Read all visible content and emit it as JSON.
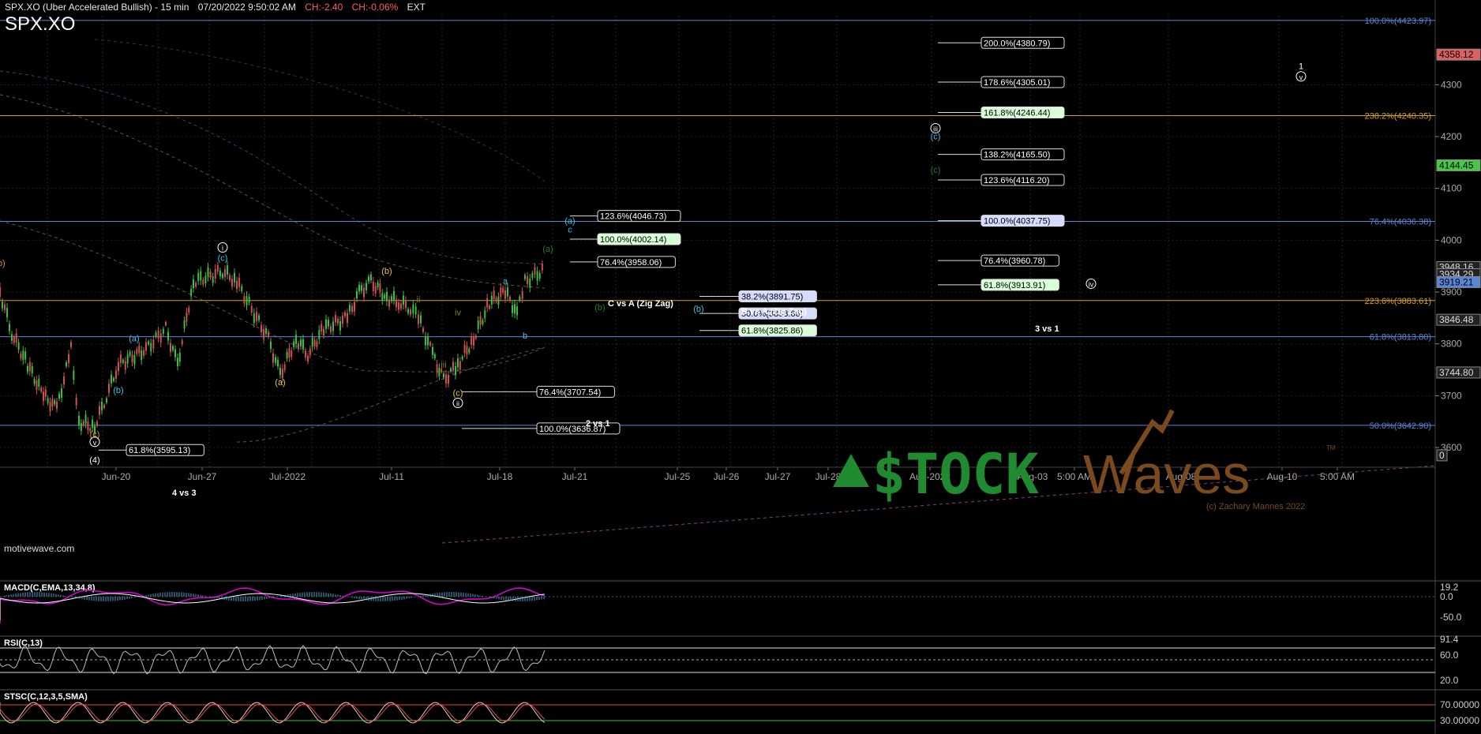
{
  "header": {
    "title": "SPX.XO (Uber Accelerated Bullish) - 15 min",
    "timestamp": "07/20/2022 9:50:02 AM",
    "change_points": "CH:-2.40",
    "change_percent": "CH:-0.06%",
    "session": "EXT",
    "symbol": "SPX.XO"
  },
  "footer": {
    "watermark": "motivewave.com"
  },
  "logo": {
    "brand": "STOCKWaves",
    "brand_part1": "$TOCK",
    "brand_part2": "Waves",
    "tm": "TM",
    "copyright": "(c) Zachary Mannes 2022"
  },
  "colors": {
    "background": "#000000",
    "up": "#3cbf3c",
    "down": "#d05050",
    "fib_blue": "#5a86d8",
    "fib_gold": "#d4a017",
    "cyan": "#33c6e0"
  },
  "chart_data": {
    "type": "line",
    "price_axis": {
      "ticks": [
        4300,
        4200,
        4100,
        4000,
        3900,
        3800,
        3700,
        3600
      ],
      "range": [
        3560,
        4433
      ]
    },
    "time_axis": {
      "labels": [
        "Jun-20",
        "Jun-27",
        "Jul-2022",
        "Jul-11",
        "Jul-18",
        "Jul-21",
        "Jul-25",
        "Jul-26",
        "Jul-27",
        "Jul-28",
        "Aug-2022",
        "Aug-03",
        "5:00 AM",
        "Aug-08",
        "Aug-10",
        "5:00 AM"
      ]
    },
    "price_path": [
      [
        "06-14",
        3900
      ],
      [
        "06-15",
        3820
      ],
      [
        "06-16",
        3760
      ],
      [
        "06-16b",
        3700
      ],
      [
        "06-17",
        3675
      ],
      [
        "06-17b",
        3790
      ],
      [
        "06-17c",
        3650
      ],
      [
        "06-19",
        3640
      ],
      [
        "06-21",
        3700
      ],
      [
        "06-22",
        3760
      ],
      [
        "06-23",
        3790
      ],
      [
        "06-24",
        3830
      ],
      [
        "06-25",
        3760
      ],
      [
        "06-26",
        3920
      ],
      [
        "06-27",
        3940
      ],
      [
        "06-28",
        3920
      ],
      [
        "06-29",
        3850
      ],
      [
        "06-30",
        3810
      ],
      [
        "07-01",
        3740
      ],
      [
        "07-02",
        3810
      ],
      [
        "07-04",
        3780
      ],
      [
        "07-05",
        3830
      ],
      [
        "07-06",
        3850
      ],
      [
        "07-07",
        3900
      ],
      [
        "07-08",
        3920
      ],
      [
        "07-09",
        3890
      ],
      [
        "07-10",
        3880
      ],
      [
        "07-11",
        3870
      ],
      [
        "07-12",
        3850
      ],
      [
        "07-13",
        3780
      ],
      [
        "07-14",
        3730
      ],
      [
        "07-15",
        3760
      ],
      [
        "07-16",
        3810
      ],
      [
        "07-17",
        3880
      ],
      [
        "07-18",
        3900
      ],
      [
        "07-18b",
        3860
      ],
      [
        "07-19",
        3920
      ],
      [
        "07-20",
        3945
      ]
    ],
    "fib_levels": [
      {
        "label": "100.0%(4423.97)",
        "value": 4423.97,
        "color": "blue"
      },
      {
        "label": "238.2%(4240.35)",
        "value": 4240.35,
        "color": "gold"
      },
      {
        "label": "76.4%(4036.38)",
        "value": 4036.38,
        "color": "blue"
      },
      {
        "label": "223.6%(3883.61)",
        "value": 3883.61,
        "color": "gold"
      },
      {
        "label": "61.8%(3813.80)",
        "value": 3813.8,
        "color": "blue"
      },
      {
        "label": "50.0%(3642.90)",
        "value": 3642.9,
        "color": "blue"
      }
    ],
    "projection_boxes": [
      {
        "label": "200.0%(4380.79)",
        "value": 4380.79,
        "style": "plain",
        "group": "right"
      },
      {
        "label": "178.6%(4305.01)",
        "value": 4305.01,
        "style": "plain",
        "group": "right"
      },
      {
        "label": "161.8%(4246.44)",
        "value": 4246.44,
        "style": "green",
        "group": "right"
      },
      {
        "label": "138.2%(4165.50)",
        "value": 4165.5,
        "style": "plain",
        "group": "right"
      },
      {
        "label": "123.6%(4116.20)",
        "value": 4116.2,
        "style": "plain",
        "group": "right"
      },
      {
        "label": "100.0%(4037.75)",
        "value": 4037.75,
        "style": "blue",
        "group": "right"
      },
      {
        "label": "76.4%(3960.78)",
        "value": 3960.78,
        "style": "plain",
        "group": "right"
      },
      {
        "label": "61.8%(3913.91)",
        "value": 3913.91,
        "style": "green",
        "group": "right"
      },
      {
        "label": "123.6%(4046.73)",
        "value": 4046.73,
        "style": "plain",
        "group": "mid"
      },
      {
        "label": "100.0%(4002.14)",
        "value": 4002.14,
        "style": "green",
        "group": "mid"
      },
      {
        "label": "76.4%(3958.06)",
        "value": 3958.06,
        "style": "plain",
        "group": "mid"
      },
      {
        "label": "38.2%(3891.75)",
        "value": 3891.75,
        "style": "blue",
        "group": "b"
      },
      {
        "label": "50.0%(3858.66)",
        "value": 3858.66,
        "style": "blue",
        "group": "b"
      },
      {
        "label": "61.8%(3825.86)",
        "value": 3825.86,
        "style": "green",
        "group": "b"
      },
      {
        "label": "76.4%(3707.54)",
        "value": 3707.54,
        "style": "plain",
        "group": "low"
      },
      {
        "label": "100.0%(3636.87)",
        "value": 3636.87,
        "style": "plain",
        "group": "low"
      },
      {
        "label": "61.8%(3595.13)",
        "value": 3595.13,
        "style": "plain",
        "group": "left"
      }
    ],
    "group_titles": {
      "mid": "C vs A (Zig Zag)",
      "b": "B vs A (Zig Zag)",
      "right": "3 vs 1",
      "low": "2 vs 1",
      "left": "4 vs 3"
    },
    "axis_badges": [
      {
        "label": "100.0%(4423.97)",
        "value": 4423.97,
        "style": "fibtext"
      },
      {
        "label": "4358.12",
        "value": 4358.12,
        "style": "red"
      },
      {
        "label": "4144.45",
        "value": 4144.45,
        "style": "green"
      },
      {
        "label": "3948.16",
        "value": 3948.16,
        "style": "plain"
      },
      {
        "label": "3934.29",
        "value": 3934.29,
        "style": "plain"
      },
      {
        "label": "3919.21",
        "value": 3919.21,
        "style": "blue"
      },
      {
        "label": "3846.48",
        "value": 3846.48,
        "style": "plain"
      },
      {
        "label": "3744.80",
        "value": 3744.8,
        "style": "plain"
      },
      {
        "label": "0",
        "value": 3585,
        "style": "plain"
      }
    ],
    "wave_labels": [
      {
        "t": "(b)",
        "d": "06-14",
        "v": 3950,
        "c": "#e08a3c"
      },
      {
        "t": "(a)",
        "d": "06-22b",
        "v": 3805,
        "c": "#33c6e0"
      },
      {
        "t": "(b)",
        "d": "06-22",
        "v": 3705,
        "c": "#33c6e0"
      },
      {
        "t": "(c)",
        "d": "06-19",
        "v": 3620,
        "c": "#e08a3c"
      },
      {
        "t": "(4)",
        "d": "06-19",
        "v": 3570,
        "c": "#ffffff"
      },
      {
        "t": "(c)",
        "d": "06-27",
        "v": 3960,
        "c": "#33c6e0"
      },
      {
        "t": "(a)",
        "d": "07-01",
        "v": 3720,
        "c": "#e6c84a"
      },
      {
        "t": "(b)",
        "d": "07-09",
        "v": 3935,
        "c": "#e6c84a"
      },
      {
        "t": "ii",
        "d": "07-12",
        "v": 3880,
        "c": "#8a7a3a"
      },
      {
        "t": "iv",
        "d": "07-15",
        "v": 3855,
        "c": "#8a7a3a"
      },
      {
        "t": "iii",
        "d": "07-14",
        "v": 3755,
        "c": "#8a7a3a"
      },
      {
        "t": "(c)",
        "d": "07-15",
        "v": 3700,
        "c": "#e6c84a"
      },
      {
        "t": "a",
        "d": "07-18",
        "v": 3915,
        "c": "#33c6e0"
      },
      {
        "t": "b",
        "d": "07-19",
        "v": 3810,
        "c": "#33c6e0"
      },
      {
        "t": "c",
        "d": "07-20c",
        "v": 4015,
        "c": "#33c6e0"
      },
      {
        "t": "(a)",
        "d": "07-20c",
        "v": 4032,
        "c": "#33c6e0"
      },
      {
        "t": "(a)",
        "d": "07-21",
        "v": 3978,
        "c": "#2a7a2a"
      },
      {
        "t": "(b)",
        "d": "07-22",
        "v": 3865,
        "c": "#2a7a2a"
      },
      {
        "t": "(b)",
        "d": "07-26",
        "v": 3862,
        "c": "#33c6e0"
      },
      {
        "t": "(c)",
        "d": "08-02",
        "v": 4130,
        "c": "#2a7a2a"
      },
      {
        "t": "(c)",
        "d": "08-02",
        "v": 4195,
        "c": "#33c6e0"
      },
      {
        "t": "1",
        "d": "08-11",
        "v": 4330,
        "c": "#ffffff"
      }
    ],
    "circled_labels": [
      {
        "t": "i",
        "d": "06-27",
        "v": 3980
      },
      {
        "t": "ii",
        "d": "07-15",
        "v": 3680
      },
      {
        "t": "iii",
        "d": "08-02",
        "v": 4210
      },
      {
        "t": "iv",
        "d": "08-05",
        "v": 3910
      },
      {
        "t": "v",
        "d": "08-11",
        "v": 4310
      },
      {
        "t": "v",
        "d": "06-19",
        "v": 3605
      }
    ],
    "macd": {
      "label": "MACD(C,EMA,13,34,8)",
      "ticks": [
        "19.2",
        "0.0",
        "-50.0"
      ]
    },
    "rsi": {
      "label": "RSI(C,13)",
      "ticks": [
        "91.4",
        "60.0",
        "20.0"
      ]
    },
    "stoch": {
      "label": "STSC(C,12,3,5,SMA)",
      "ticks": [
        "70.00000",
        "30.00000"
      ]
    }
  }
}
